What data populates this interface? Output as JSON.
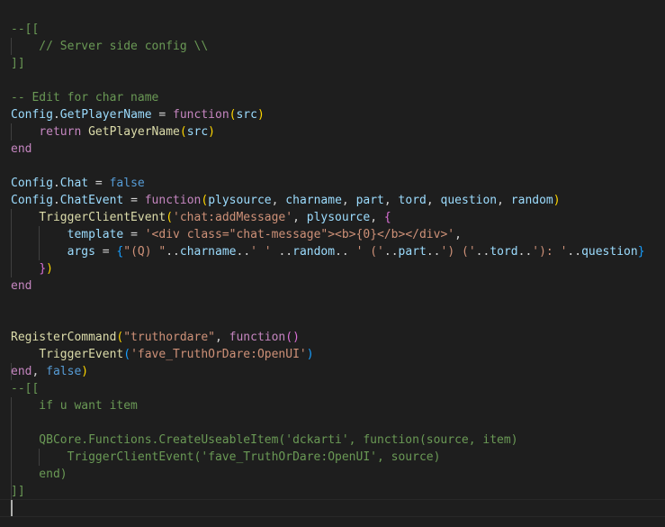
{
  "colors": {
    "background": "#1e1e1e",
    "comment": "#6a9955",
    "keyword": "#c586c0",
    "function": "#dcdcaa",
    "variable": "#9cdcfe",
    "string": "#ce9178",
    "constant": "#569cd6",
    "bracket_gold": "#ffd700",
    "bracket_purple": "#da70d6",
    "bracket_blue": "#179fff",
    "text": "#d4d4d4"
  },
  "lines": [
    {
      "tokens": [
        {
          "t": "--[[",
          "c": "comment"
        }
      ]
    },
    {
      "tokens": [
        {
          "t": "    // Server side config \\\\",
          "c": "comment"
        }
      ]
    },
    {
      "tokens": [
        {
          "t": "]]",
          "c": "comment"
        }
      ]
    },
    {
      "tokens": []
    },
    {
      "tokens": [
        {
          "t": "-- Edit for char name",
          "c": "comment"
        }
      ]
    },
    {
      "tokens": [
        {
          "t": "Config",
          "c": "variable"
        },
        {
          "t": ".",
          "c": "text"
        },
        {
          "t": "GetPlayerName",
          "c": "variable"
        },
        {
          "t": " = ",
          "c": "text"
        },
        {
          "t": "function",
          "c": "keyword"
        },
        {
          "t": "(",
          "c": "bracket_gold"
        },
        {
          "t": "src",
          "c": "variable"
        },
        {
          "t": ")",
          "c": "bracket_gold"
        }
      ]
    },
    {
      "tokens": [
        {
          "t": "    ",
          "c": "text"
        },
        {
          "t": "return",
          "c": "keyword"
        },
        {
          "t": " ",
          "c": "text"
        },
        {
          "t": "GetPlayerName",
          "c": "function"
        },
        {
          "t": "(",
          "c": "bracket_gold"
        },
        {
          "t": "src",
          "c": "variable"
        },
        {
          "t": ")",
          "c": "bracket_gold"
        }
      ]
    },
    {
      "tokens": [
        {
          "t": "end",
          "c": "keyword"
        }
      ]
    },
    {
      "tokens": []
    },
    {
      "tokens": [
        {
          "t": "Config",
          "c": "variable"
        },
        {
          "t": ".",
          "c": "text"
        },
        {
          "t": "Chat",
          "c": "variable"
        },
        {
          "t": " = ",
          "c": "text"
        },
        {
          "t": "false",
          "c": "constant"
        }
      ]
    },
    {
      "tokens": [
        {
          "t": "Config",
          "c": "variable"
        },
        {
          "t": ".",
          "c": "text"
        },
        {
          "t": "ChatEvent",
          "c": "variable"
        },
        {
          "t": " = ",
          "c": "text"
        },
        {
          "t": "function",
          "c": "keyword"
        },
        {
          "t": "(",
          "c": "bracket_gold"
        },
        {
          "t": "plysource",
          "c": "variable"
        },
        {
          "t": ", ",
          "c": "text"
        },
        {
          "t": "charname",
          "c": "variable"
        },
        {
          "t": ", ",
          "c": "text"
        },
        {
          "t": "part",
          "c": "variable"
        },
        {
          "t": ", ",
          "c": "text"
        },
        {
          "t": "tord",
          "c": "variable"
        },
        {
          "t": ", ",
          "c": "text"
        },
        {
          "t": "question",
          "c": "variable"
        },
        {
          "t": ", ",
          "c": "text"
        },
        {
          "t": "random",
          "c": "variable"
        },
        {
          "t": ")",
          "c": "bracket_gold"
        }
      ]
    },
    {
      "tokens": [
        {
          "t": "    ",
          "c": "text"
        },
        {
          "t": "TriggerClientEvent",
          "c": "function"
        },
        {
          "t": "(",
          "c": "bracket_gold"
        },
        {
          "t": "'chat:addMessage'",
          "c": "string"
        },
        {
          "t": ", ",
          "c": "text"
        },
        {
          "t": "plysource",
          "c": "variable"
        },
        {
          "t": ", ",
          "c": "text"
        },
        {
          "t": "{",
          "c": "bracket_purple"
        }
      ]
    },
    {
      "tokens": [
        {
          "t": "        ",
          "c": "text"
        },
        {
          "t": "template",
          "c": "variable"
        },
        {
          "t": " = ",
          "c": "text"
        },
        {
          "t": "'<div class=\"chat-message\"><b>{0}</b></div>'",
          "c": "string"
        },
        {
          "t": ",",
          "c": "text"
        }
      ]
    },
    {
      "tokens": [
        {
          "t": "        ",
          "c": "text"
        },
        {
          "t": "args",
          "c": "variable"
        },
        {
          "t": " = ",
          "c": "text"
        },
        {
          "t": "{",
          "c": "bracket_blue"
        },
        {
          "t": "\"(Q) \"",
          "c": "string"
        },
        {
          "t": "..",
          "c": "text"
        },
        {
          "t": "charname",
          "c": "variable"
        },
        {
          "t": "..",
          "c": "text"
        },
        {
          "t": "' '",
          "c": "string"
        },
        {
          "t": " ..",
          "c": "text"
        },
        {
          "t": "random",
          "c": "variable"
        },
        {
          "t": ".. ",
          "c": "text"
        },
        {
          "t": "' ('",
          "c": "string"
        },
        {
          "t": "..",
          "c": "text"
        },
        {
          "t": "part",
          "c": "variable"
        },
        {
          "t": "..",
          "c": "text"
        },
        {
          "t": "') ('",
          "c": "string"
        },
        {
          "t": "..",
          "c": "text"
        },
        {
          "t": "tord",
          "c": "variable"
        },
        {
          "t": "..",
          "c": "text"
        },
        {
          "t": "'): '",
          "c": "string"
        },
        {
          "t": "..",
          "c": "text"
        },
        {
          "t": "question",
          "c": "variable"
        },
        {
          "t": "}",
          "c": "bracket_blue"
        }
      ]
    },
    {
      "tokens": [
        {
          "t": "    ",
          "c": "text"
        },
        {
          "t": "}",
          "c": "bracket_purple"
        },
        {
          "t": ")",
          "c": "bracket_gold"
        }
      ]
    },
    {
      "tokens": [
        {
          "t": "end",
          "c": "keyword"
        }
      ]
    },
    {
      "tokens": []
    },
    {
      "tokens": []
    },
    {
      "tokens": [
        {
          "t": "RegisterCommand",
          "c": "function"
        },
        {
          "t": "(",
          "c": "bracket_gold"
        },
        {
          "t": "\"truthordare\"",
          "c": "string"
        },
        {
          "t": ", ",
          "c": "text"
        },
        {
          "t": "function",
          "c": "keyword"
        },
        {
          "t": "(",
          "c": "bracket_purple"
        },
        {
          "t": ")",
          "c": "bracket_purple"
        }
      ]
    },
    {
      "tokens": [
        {
          "t": "    ",
          "c": "text"
        },
        {
          "t": "TriggerEvent",
          "c": "function"
        },
        {
          "t": "(",
          "c": "bracket_blue"
        },
        {
          "t": "'fave_TruthOrDare:OpenUI'",
          "c": "string"
        },
        {
          "t": ")",
          "c": "bracket_blue"
        }
      ]
    },
    {
      "tokens": [
        {
          "t": "end",
          "c": "keyword"
        },
        {
          "t": ", ",
          "c": "text"
        },
        {
          "t": "false",
          "c": "constant"
        },
        {
          "t": ")",
          "c": "bracket_gold"
        }
      ]
    },
    {
      "tokens": [
        {
          "t": "--[[",
          "c": "comment"
        }
      ]
    },
    {
      "tokens": [
        {
          "t": "    if u want item",
          "c": "comment"
        }
      ]
    },
    {
      "tokens": []
    },
    {
      "tokens": [
        {
          "t": "    QBCore.Functions.CreateUseableItem('dckarti', function(source, item)",
          "c": "comment"
        }
      ]
    },
    {
      "tokens": [
        {
          "t": "        TriggerClientEvent('fave_TruthOrDare:OpenUI', source)",
          "c": "comment"
        }
      ]
    },
    {
      "tokens": [
        {
          "t": "    end)",
          "c": "comment"
        }
      ]
    },
    {
      "tokens": [
        {
          "t": "]]",
          "c": "comment"
        }
      ]
    }
  ]
}
